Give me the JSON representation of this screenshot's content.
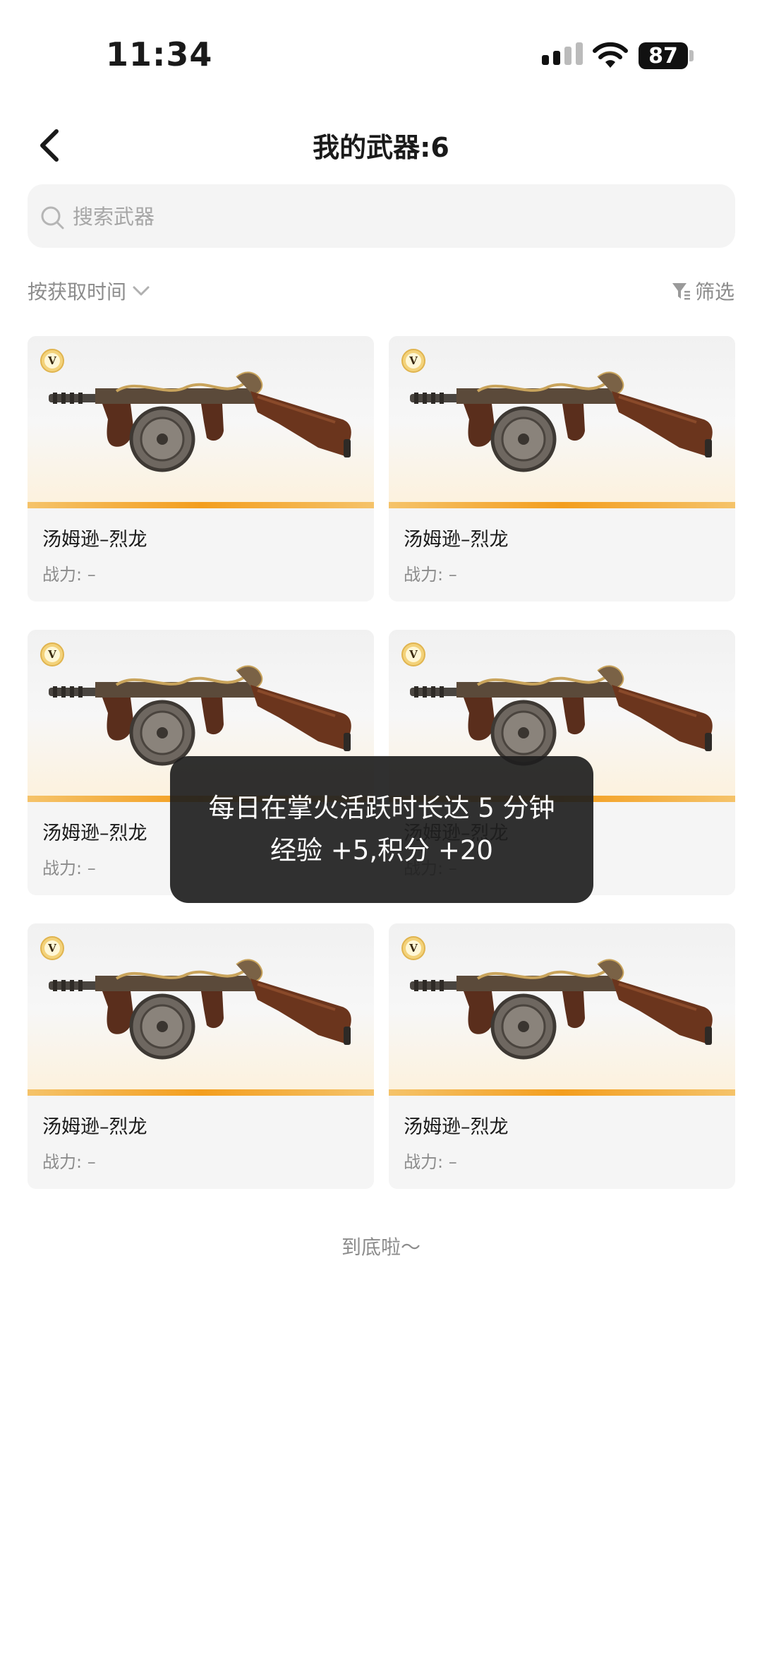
{
  "status": {
    "time": "11:34",
    "battery": "87"
  },
  "header": {
    "title": "我的武器:6"
  },
  "search": {
    "placeholder": "搜索武器"
  },
  "toolbar": {
    "sort_label": "按获取时间",
    "filter_label": "筛选"
  },
  "badge_letter": "V",
  "weapons": [
    {
      "name": "汤姆逊–烈龙",
      "power": "战力: –"
    },
    {
      "name": "汤姆逊–烈龙",
      "power": "战力: –"
    },
    {
      "name": "汤姆逊–烈龙",
      "power": "战力: –"
    },
    {
      "name": "汤姆逊–烈龙",
      "power": "战力: –"
    },
    {
      "name": "汤姆逊–烈龙",
      "power": "战力: –"
    },
    {
      "name": "汤姆逊–烈龙",
      "power": "战力: –"
    }
  ],
  "footer": {
    "end_text": "到底啦～"
  },
  "toast": {
    "line1": "每日在掌火活跃时长达 5 分钟",
    "line2": "经验 +5,积分 +20"
  },
  "colors": {
    "accent": "#f39e1e",
    "muted": "#8c8c8c",
    "card_bg": "#f5f5f5",
    "toast_bg": "#1e1e1e"
  }
}
